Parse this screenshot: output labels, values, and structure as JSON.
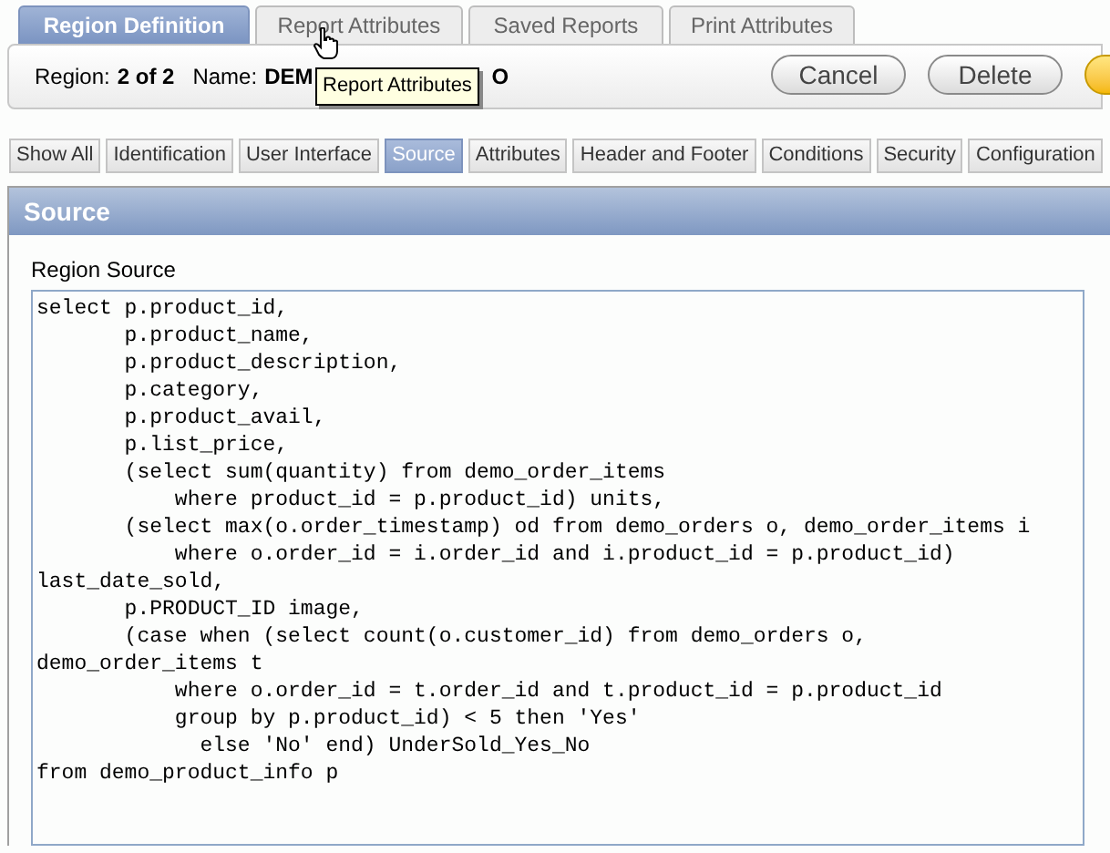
{
  "tabs": [
    {
      "label": "Region Definition",
      "selected": true
    },
    {
      "label": "Report Attributes",
      "selected": false
    },
    {
      "label": "Saved Reports",
      "selected": false
    },
    {
      "label": "Print Attributes",
      "selected": false
    }
  ],
  "tooltip": "Report Attributes",
  "region_info": {
    "region_label": "Region:",
    "region_value": "2 of 2",
    "name_label": "Name:",
    "name_value": "DEM",
    "name_tail": "O"
  },
  "buttons": [
    {
      "label": "Cancel",
      "kind": "plain"
    },
    {
      "label": "Delete",
      "kind": "plain"
    },
    {
      "kind": "primary"
    }
  ],
  "section_tabs": [
    {
      "label": "Show All",
      "selected": false
    },
    {
      "label": "Identification",
      "selected": false
    },
    {
      "label": "User Interface",
      "selected": false
    },
    {
      "label": "Source",
      "selected": true
    },
    {
      "label": "Attributes",
      "selected": false
    },
    {
      "label": "Header and Footer",
      "selected": false
    },
    {
      "label": "Conditions",
      "selected": false
    },
    {
      "label": "Security",
      "selected": false
    },
    {
      "label": "Configuration",
      "selected": false
    }
  ],
  "panel": {
    "title": "Source",
    "field_label": "Region Source",
    "code_lines": [
      "select p.product_id,",
      "       p.product_name,",
      "       p.product_description,",
      "       p.category,",
      "       p.product_avail,",
      "       p.list_price,",
      "       (select sum(quantity) from demo_order_items",
      "           where product_id = p.product_id) units,",
      "       (select max(o.order_timestamp) od from demo_orders o, demo_order_items i",
      "           where o.order_id = i.order_id and i.product_id = p.product_id)",
      "last_date_sold,",
      "       p.PRODUCT_ID image,",
      "       (case when (select count(o.customer_id) from demo_orders o,",
      "demo_order_items t",
      "           where o.order_id = t.order_id and t.product_id = p.product_id",
      "           group by p.product_id) < 5 then 'Yes'",
      "             else 'No' end) UnderSold_Yes_No",
      "from demo_product_info p"
    ]
  }
}
